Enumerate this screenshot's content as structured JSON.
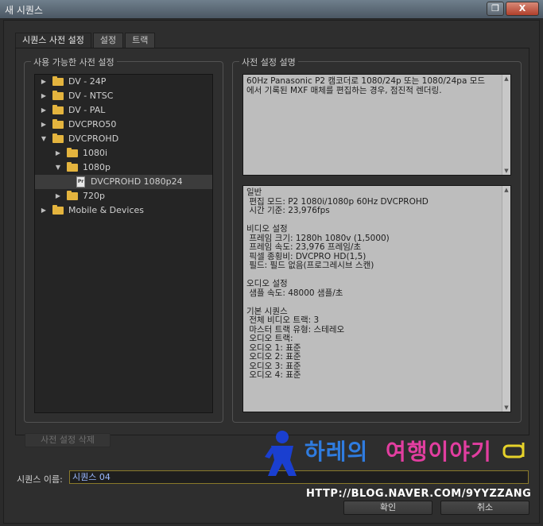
{
  "window": {
    "title": "새 시퀀스",
    "restore_icon": "restore-icon",
    "close_label": "X"
  },
  "tabs": [
    {
      "label": "시퀀스 사전 설정",
      "active": true
    },
    {
      "label": "설정",
      "active": false
    },
    {
      "label": "트랙",
      "active": false
    }
  ],
  "presets_panel": {
    "title": "사용 가능한 사전 설정",
    "tree": [
      {
        "label": "DV - 24P",
        "level": 0,
        "expanded": false,
        "type": "folder"
      },
      {
        "label": "DV - NTSC",
        "level": 0,
        "expanded": false,
        "type": "folder"
      },
      {
        "label": "DV - PAL",
        "level": 0,
        "expanded": false,
        "type": "folder"
      },
      {
        "label": "DVCPRO50",
        "level": 0,
        "expanded": false,
        "type": "folder"
      },
      {
        "label": "DVCPROHD",
        "level": 0,
        "expanded": true,
        "type": "folder"
      },
      {
        "label": "1080i",
        "level": 1,
        "expanded": false,
        "type": "folder"
      },
      {
        "label": "1080p",
        "level": 1,
        "expanded": true,
        "type": "folder"
      },
      {
        "label": "DVCPROHD 1080p24",
        "level": 2,
        "type": "file",
        "selected": true,
        "file_badge": "Pr"
      },
      {
        "label": "720p",
        "level": 1,
        "expanded": false,
        "type": "folder"
      },
      {
        "label": "Mobile & Devices",
        "level": 0,
        "expanded": false,
        "type": "folder"
      }
    ],
    "delete_button": "사전 설정 삭제"
  },
  "description_panel": {
    "title": "사전 설정 설명",
    "description": "60Hz Panasonic P2 캠코더로 1080/24p 또는 1080/24pa 모드\n에서 기록된 MXF 매체를 편집하는 경우, 점진적 렌더링.",
    "details": "일반\n 편집 모드: P2 1080i/1080p 60Hz DVCPROHD\n 시간 기준: 23,976fps\n\n비디오 설정\n 프레임 크기: 1280h 1080v (1,5000)\n 프레임 속도: 23,976 프레임/초\n 픽셀 종횡비: DVCPRO HD(1,5)\n 필드: 필드 없음(프로그레시브 스캔)\n\n오디오 설정\n 샘플 속도: 48000 샘플/초\n\n기본 시퀀스\n 전체 비디오 트랙: 3\n 마스터 트랙 유형: 스테레오\n 오디오 트랙:\n 오디오 1: 표준\n 오디오 2: 표준\n 오디오 3: 표준\n 오디오 4: 표준"
  },
  "sequence_name": {
    "label": "시퀀스 이름:",
    "value": "시퀀스 04"
  },
  "buttons": {
    "ok": "확인",
    "cancel": "취소"
  },
  "watermark": {
    "part1": "하레의",
    "part2": "여행이야기",
    "url": "HTTP://BLOG.NAVER.COM/9YYZZANG"
  },
  "colors": {
    "folder": "#e4b43e",
    "accent_blue": "#2f7ce0",
    "accent_pink": "#e23ea0"
  }
}
